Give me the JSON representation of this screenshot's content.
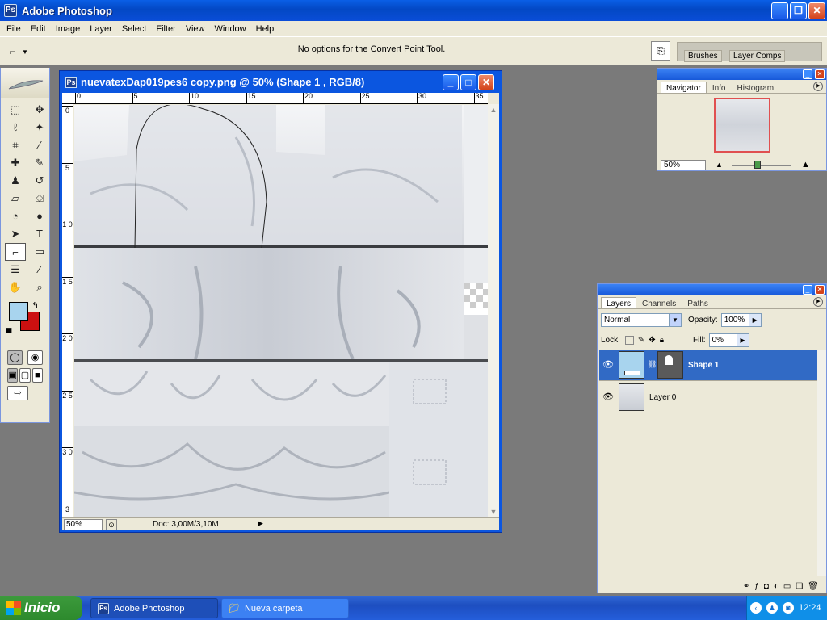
{
  "app": {
    "title": "Adobe Photoshop"
  },
  "menu": [
    "File",
    "Edit",
    "Image",
    "Layer",
    "Select",
    "Filter",
    "View",
    "Window",
    "Help"
  ],
  "options_bar": {
    "message": "No options for the Convert Point Tool.",
    "well_tabs": [
      "Brushes",
      "Layer Comps"
    ]
  },
  "toolbox": {
    "tools": [
      {
        "name": "marquee",
        "glyph": "⬚"
      },
      {
        "name": "move",
        "glyph": "✥"
      },
      {
        "name": "lasso",
        "glyph": "ℓ"
      },
      {
        "name": "magic-wand",
        "glyph": "✦"
      },
      {
        "name": "crop",
        "glyph": "⌗"
      },
      {
        "name": "slice",
        "glyph": "⁄"
      },
      {
        "name": "healing",
        "glyph": "✚"
      },
      {
        "name": "brush",
        "glyph": "✎"
      },
      {
        "name": "stamp",
        "glyph": "♟"
      },
      {
        "name": "history-brush",
        "glyph": "↺"
      },
      {
        "name": "eraser",
        "glyph": "▱"
      },
      {
        "name": "paint-bucket",
        "glyph": "⛋"
      },
      {
        "name": "blur",
        "glyph": "◔"
      },
      {
        "name": "dodge",
        "glyph": "●"
      },
      {
        "name": "path-select",
        "glyph": "➤"
      },
      {
        "name": "type",
        "glyph": "T"
      },
      {
        "name": "convert-point",
        "glyph": "⌐"
      },
      {
        "name": "rectangle",
        "glyph": "▭"
      },
      {
        "name": "notes",
        "glyph": "☰"
      },
      {
        "name": "eyedropper",
        "glyph": "⁄"
      },
      {
        "name": "hand",
        "glyph": "✋"
      },
      {
        "name": "zoom",
        "glyph": "⌕"
      }
    ],
    "foreground_color": "#a8d4ee",
    "background_color": "#cc1010"
  },
  "document": {
    "title": "nuevatexDap019pes6 copy.png @ 50% (Shape 1 , RGB/8)",
    "ruler_top": [
      "0",
      "5",
      "10",
      "15",
      "20",
      "25",
      "30",
      "35"
    ],
    "ruler_left": [
      "0",
      "5",
      "1 0",
      "1 5",
      "2 0",
      "2 5",
      "3 0",
      "3"
    ],
    "zoom": "50%",
    "doc_size": "Doc: 3,00M/3,10M"
  },
  "navigator": {
    "tabs": [
      "Navigator",
      "Info",
      "Histogram"
    ],
    "zoom": "50%"
  },
  "layers_panel": {
    "tabs": [
      "Layers",
      "Channels",
      "Paths"
    ],
    "blend_mode": "Normal",
    "opacity_label": "Opacity:",
    "opacity": "100%",
    "lock_label": "Lock:",
    "fill_label": "Fill:",
    "fill": "0%",
    "layers": [
      {
        "name": "Shape 1",
        "selected": true
      },
      {
        "name": "Layer 0",
        "selected": false
      }
    ]
  },
  "taskbar": {
    "start": "Inicio",
    "tasks": [
      "Adobe Photoshop",
      "Nueva carpeta"
    ],
    "clock": "12:24"
  }
}
